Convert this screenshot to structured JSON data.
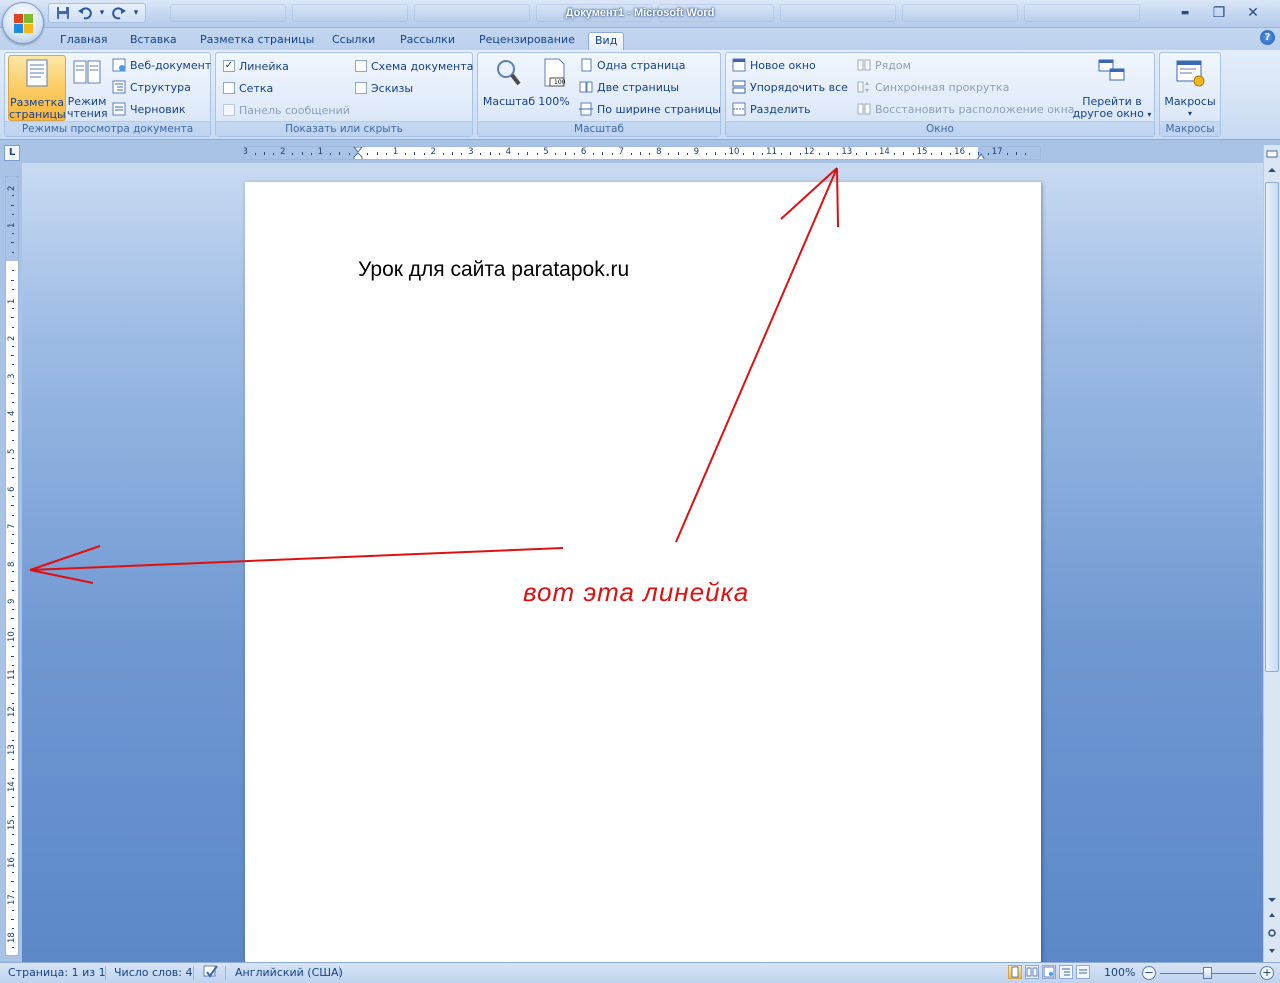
{
  "window": {
    "title": "Документ1 - Microsoft Word",
    "controls": {
      "minimize": "▬",
      "restore": "❐",
      "close": "✕"
    }
  },
  "quick_access": {
    "customize": "▾"
  },
  "tabs": [
    {
      "label": "Главная"
    },
    {
      "label": "Вставка"
    },
    {
      "label": "Разметка страницы"
    },
    {
      "label": "Ссылки"
    },
    {
      "label": "Рассылки"
    },
    {
      "label": "Рецензирование"
    },
    {
      "label": "Вид",
      "active": true
    }
  ],
  "help": {
    "label": "?"
  },
  "ribbon": {
    "views": {
      "label": "Режимы просмотра документа",
      "print_layout": {
        "line1": "Разметка",
        "line2": "страницы"
      },
      "reading": {
        "line1": "Режим",
        "line2": "чтения"
      },
      "web": "Веб-документ",
      "outline": "Структура",
      "draft": "Черновик"
    },
    "show_hide": {
      "label": "Показать или скрыть",
      "ruler": {
        "text": "Линейка",
        "checked": "✓"
      },
      "grid": "Сетка",
      "message_bar": "Панель сообщений",
      "doc_map": "Схема документа",
      "thumbnails": "Эскизы"
    },
    "zoom": {
      "label": "Масштаб",
      "zoom_btn": "Масштаб",
      "percent_btn": "100%",
      "percent_icon_text": "100",
      "one_page": "Одна страница",
      "two_pages": "Две страницы",
      "page_width": "По ширине страницы"
    },
    "window": {
      "label": "Окно",
      "new_window": "Новое окно",
      "arrange_all": "Упорядочить все",
      "split": "Разделить",
      "side_by_side": "Рядом",
      "sync_scroll": "Синхронная прокрутка",
      "reset_position": "Восстановить расположение окна",
      "switch": {
        "line1": "Перейти в",
        "line2": "другое окно",
        "arrow": "▾"
      }
    },
    "macros": {
      "label": "Макросы",
      "btn": "Макросы",
      "arrow": "▾"
    }
  },
  "ruler": {
    "corner": "L",
    "h_left_labels": [
      "3",
      "2",
      "1"
    ],
    "h_right_labels": [
      "1",
      "2",
      "3",
      "4",
      "5",
      "6",
      "7",
      "8",
      "9",
      "10",
      "11",
      "12",
      "13",
      "14",
      "15",
      "16",
      "17"
    ],
    "v_top_labels": [
      "2",
      "1"
    ],
    "v_labels": [
      "1",
      "2",
      "3",
      "4",
      "5",
      "6",
      "7",
      "8",
      "9",
      "10",
      "11",
      "12",
      "13",
      "14",
      "15",
      "16",
      "17",
      "18"
    ]
  },
  "document": {
    "heading": "Урок для сайта paratapok.ru"
  },
  "annotation": {
    "text": "вот эта линейка",
    "color": "#e01010"
  },
  "statusbar": {
    "page": "Страница: 1 из 1",
    "words": "Число слов: 4",
    "language": "Английский (США)",
    "zoom": "100%",
    "zoom_minus": "−",
    "zoom_plus": "+",
    "zoom_fraction": 0.5
  },
  "colors": {
    "accent": "#15428b",
    "annotation": "#e01010",
    "active_button": "#fbcf69"
  }
}
